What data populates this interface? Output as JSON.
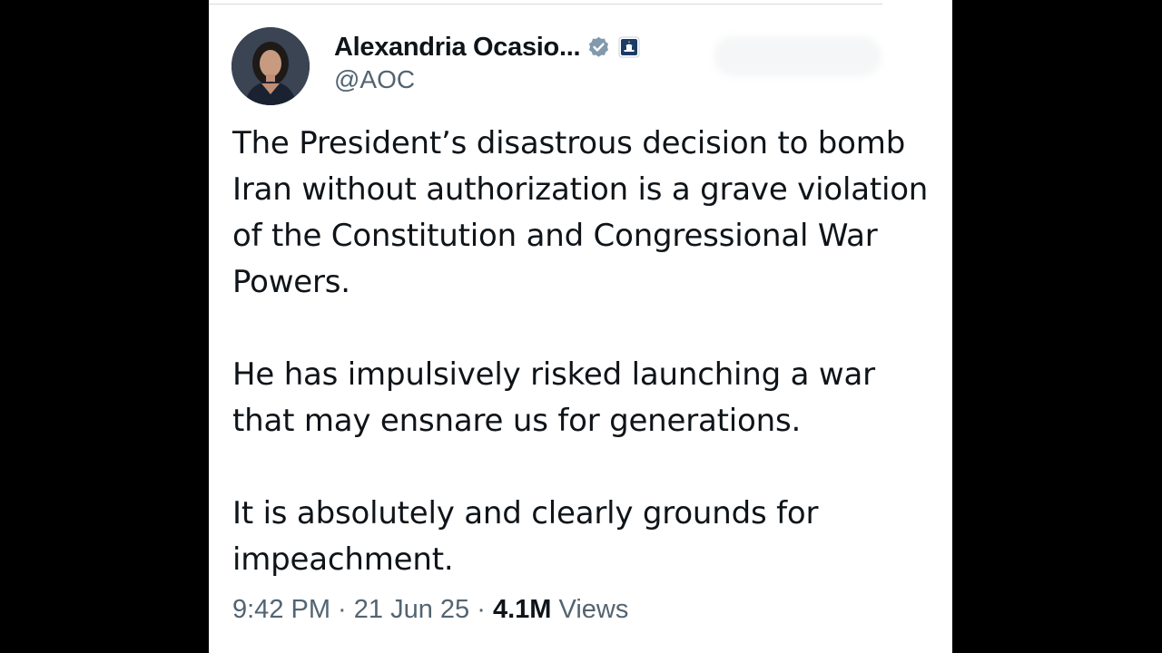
{
  "tweet": {
    "author": {
      "display_name": "Alexandria Ocasio...",
      "handle": "@AOC",
      "verified_icon": "verified-badge-icon",
      "affiliation_icon": "capitol-building-icon"
    },
    "paragraphs": [
      "The President’s disastrous decision to bomb Iran without authorization is a grave violation of the Constitution and Congressional War Powers.",
      "He has impulsively risked launching a war that may ensnare us for generations.",
      "It is absolutely and clearly grounds for impeachment."
    ],
    "meta": {
      "time": "9:42 PM",
      "separator": " · ",
      "date": "21 Jun 25",
      "views_count": "4.1M",
      "views_label": " Views"
    }
  },
  "colors": {
    "background": "#000000",
    "card": "#ffffff",
    "text_primary": "#0f1419",
    "text_secondary": "#536471",
    "verified_badge": "#829aab",
    "affiliation_badge": "#1c3a66"
  }
}
